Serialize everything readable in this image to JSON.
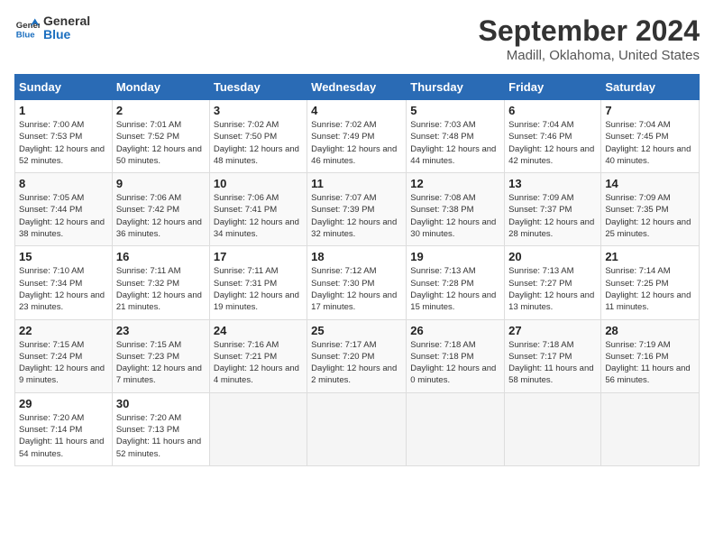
{
  "logo": {
    "line1": "General",
    "line2": "Blue"
  },
  "title": "September 2024",
  "subtitle": "Madill, Oklahoma, United States",
  "headers": [
    "Sunday",
    "Monday",
    "Tuesday",
    "Wednesday",
    "Thursday",
    "Friday",
    "Saturday"
  ],
  "weeks": [
    [
      {
        "day": "1",
        "sunrise": "7:00 AM",
        "sunset": "7:53 PM",
        "daylight": "12 hours and 52 minutes."
      },
      {
        "day": "2",
        "sunrise": "7:01 AM",
        "sunset": "7:52 PM",
        "daylight": "12 hours and 50 minutes."
      },
      {
        "day": "3",
        "sunrise": "7:02 AM",
        "sunset": "7:50 PM",
        "daylight": "12 hours and 48 minutes."
      },
      {
        "day": "4",
        "sunrise": "7:02 AM",
        "sunset": "7:49 PM",
        "daylight": "12 hours and 46 minutes."
      },
      {
        "day": "5",
        "sunrise": "7:03 AM",
        "sunset": "7:48 PM",
        "daylight": "12 hours and 44 minutes."
      },
      {
        "day": "6",
        "sunrise": "7:04 AM",
        "sunset": "7:46 PM",
        "daylight": "12 hours and 42 minutes."
      },
      {
        "day": "7",
        "sunrise": "7:04 AM",
        "sunset": "7:45 PM",
        "daylight": "12 hours and 40 minutes."
      }
    ],
    [
      {
        "day": "8",
        "sunrise": "7:05 AM",
        "sunset": "7:44 PM",
        "daylight": "12 hours and 38 minutes."
      },
      {
        "day": "9",
        "sunrise": "7:06 AM",
        "sunset": "7:42 PM",
        "daylight": "12 hours and 36 minutes."
      },
      {
        "day": "10",
        "sunrise": "7:06 AM",
        "sunset": "7:41 PM",
        "daylight": "12 hours and 34 minutes."
      },
      {
        "day": "11",
        "sunrise": "7:07 AM",
        "sunset": "7:39 PM",
        "daylight": "12 hours and 32 minutes."
      },
      {
        "day": "12",
        "sunrise": "7:08 AM",
        "sunset": "7:38 PM",
        "daylight": "12 hours and 30 minutes."
      },
      {
        "day": "13",
        "sunrise": "7:09 AM",
        "sunset": "7:37 PM",
        "daylight": "12 hours and 28 minutes."
      },
      {
        "day": "14",
        "sunrise": "7:09 AM",
        "sunset": "7:35 PM",
        "daylight": "12 hours and 25 minutes."
      }
    ],
    [
      {
        "day": "15",
        "sunrise": "7:10 AM",
        "sunset": "7:34 PM",
        "daylight": "12 hours and 23 minutes."
      },
      {
        "day": "16",
        "sunrise": "7:11 AM",
        "sunset": "7:32 PM",
        "daylight": "12 hours and 21 minutes."
      },
      {
        "day": "17",
        "sunrise": "7:11 AM",
        "sunset": "7:31 PM",
        "daylight": "12 hours and 19 minutes."
      },
      {
        "day": "18",
        "sunrise": "7:12 AM",
        "sunset": "7:30 PM",
        "daylight": "12 hours and 17 minutes."
      },
      {
        "day": "19",
        "sunrise": "7:13 AM",
        "sunset": "7:28 PM",
        "daylight": "12 hours and 15 minutes."
      },
      {
        "day": "20",
        "sunrise": "7:13 AM",
        "sunset": "7:27 PM",
        "daylight": "12 hours and 13 minutes."
      },
      {
        "day": "21",
        "sunrise": "7:14 AM",
        "sunset": "7:25 PM",
        "daylight": "12 hours and 11 minutes."
      }
    ],
    [
      {
        "day": "22",
        "sunrise": "7:15 AM",
        "sunset": "7:24 PM",
        "daylight": "12 hours and 9 minutes."
      },
      {
        "day": "23",
        "sunrise": "7:15 AM",
        "sunset": "7:23 PM",
        "daylight": "12 hours and 7 minutes."
      },
      {
        "day": "24",
        "sunrise": "7:16 AM",
        "sunset": "7:21 PM",
        "daylight": "12 hours and 4 minutes."
      },
      {
        "day": "25",
        "sunrise": "7:17 AM",
        "sunset": "7:20 PM",
        "daylight": "12 hours and 2 minutes."
      },
      {
        "day": "26",
        "sunrise": "7:18 AM",
        "sunset": "7:18 PM",
        "daylight": "12 hours and 0 minutes."
      },
      {
        "day": "27",
        "sunrise": "7:18 AM",
        "sunset": "7:17 PM",
        "daylight": "11 hours and 58 minutes."
      },
      {
        "day": "28",
        "sunrise": "7:19 AM",
        "sunset": "7:16 PM",
        "daylight": "11 hours and 56 minutes."
      }
    ],
    [
      {
        "day": "29",
        "sunrise": "7:20 AM",
        "sunset": "7:14 PM",
        "daylight": "11 hours and 54 minutes."
      },
      {
        "day": "30",
        "sunrise": "7:20 AM",
        "sunset": "7:13 PM",
        "daylight": "11 hours and 52 minutes."
      },
      null,
      null,
      null,
      null,
      null
    ]
  ],
  "labels": {
    "sunrise": "Sunrise: ",
    "sunset": "Sunset: ",
    "daylight": "Daylight: "
  }
}
